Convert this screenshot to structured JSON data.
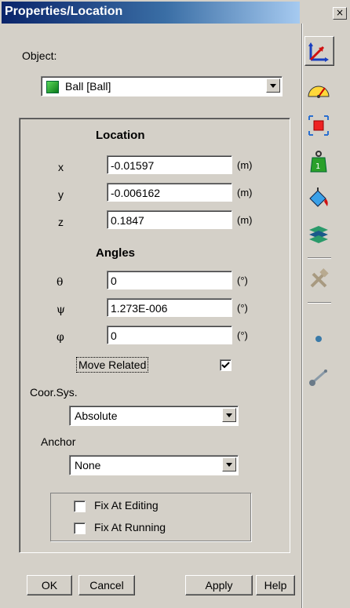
{
  "window": {
    "title": "Properties/Location",
    "close_glyph": "×"
  },
  "object": {
    "label": "Object:",
    "selected": "Ball   [Ball]"
  },
  "location": {
    "heading": "Location",
    "rows": [
      {
        "label": "x",
        "value": "-0.01597",
        "unit": "(m)"
      },
      {
        "label": "y",
        "value": "-0.006162",
        "unit": "(m)"
      },
      {
        "label": "z",
        "value": "0.1847",
        "unit": "(m)"
      }
    ]
  },
  "angles": {
    "heading": "Angles",
    "rows": [
      {
        "label": "θ",
        "value": "0",
        "unit": "(°)"
      },
      {
        "label": "ψ",
        "value": "1.273E-006",
        "unit": "(°)"
      },
      {
        "label": "φ",
        "value": "0",
        "unit": "(°)"
      }
    ]
  },
  "move_related": {
    "label": "Move Related",
    "checked": true
  },
  "coor_sys": {
    "label": "Coor.Sys.",
    "value": "Absolute"
  },
  "anchor": {
    "label": "Anchor",
    "value": "None"
  },
  "fix": {
    "editing": "Fix At Editing",
    "running": "Fix At Running"
  },
  "buttons": {
    "ok": "OK",
    "cancel": "Cancel",
    "apply": "Apply",
    "help": "Help"
  },
  "toolbar": [
    "location-icon",
    "speedometer-icon",
    "bounding-box-icon",
    "mass-weight-icon",
    "paint-bucket-icon",
    "surface-icon",
    "tools-icon",
    "point-icon",
    "link-icon"
  ]
}
